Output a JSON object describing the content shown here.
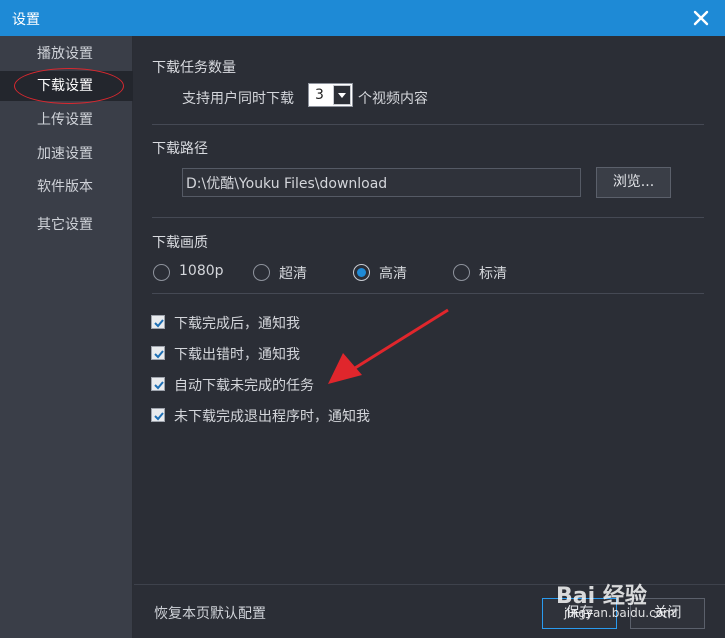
{
  "window": {
    "title": "设置"
  },
  "sidebar": {
    "items": [
      {
        "label": "播放设置"
      },
      {
        "label": "下载设置"
      },
      {
        "label": "上传设置"
      },
      {
        "label": "加速设置"
      },
      {
        "label": "软件版本"
      },
      {
        "label": "其它设置"
      }
    ],
    "active_index": 1
  },
  "download_count": {
    "title": "下载任务数量",
    "prefix": "支持用户同时下载",
    "value": "3",
    "suffix": "个视频内容"
  },
  "download_path": {
    "title": "下载路径",
    "value": "D:\\优酷\\Youku Files\\download",
    "browse_label": "浏览..."
  },
  "quality": {
    "title": "下载画质",
    "options": [
      "1080p",
      "超清",
      "高清",
      "标清"
    ],
    "selected": "高清"
  },
  "notifications": [
    {
      "label": "下载完成后，通知我",
      "checked": true
    },
    {
      "label": "下载出错时，通知我",
      "checked": true
    },
    {
      "label": "自动下载未完成的任务",
      "checked": true
    },
    {
      "label": "未下载完成退出程序时，通知我",
      "checked": true
    }
  ],
  "footer": {
    "reset_label": "恢复本页默认配置",
    "save_label": "保存",
    "close_label": "关闭"
  },
  "watermark": {
    "logo": "Bai 经验",
    "url": "jingyan.baidu.com"
  },
  "colors": {
    "titlebar": "#1e8ad6",
    "sidebar": "#3a3e48",
    "content": "#2b2e36",
    "annotation": "#e0262c"
  }
}
